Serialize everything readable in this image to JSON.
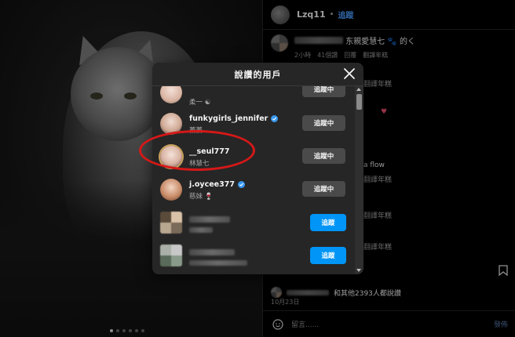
{
  "post": {
    "username": "Lzq11",
    "header_separator": "•",
    "header_follow_label": "追蹤",
    "caption_text": "东親愛慧七 🐾 的く",
    "caption_meta": [
      "2小時",
      "41個讚",
      "回覆",
      "翻譯年糕"
    ],
    "bg_comments": [
      {
        "text": "翻譯年糕"
      },
      {
        "text": "翻譯年糕"
      },
      {
        "text": "a flow"
      },
      {
        "text": "翻譯年糕"
      },
      {
        "text": "翻譯年糕"
      }
    ],
    "likes_text": "和其他2393人都說讚",
    "date": "10月23日",
    "comment_placeholder": "留言......",
    "post_button": "發佈",
    "carousel_dots": 6
  },
  "modal": {
    "title": "說讚的用戶",
    "users": [
      {
        "username": "",
        "subtitle": "柔一 ☯",
        "verified": false,
        "button": "追蹤中",
        "button_type": "following",
        "blurred": false
      },
      {
        "username": "funkygirls_jennifer",
        "subtitle": "蓁蓁",
        "verified": true,
        "button": "追蹤中",
        "button_type": "following",
        "blurred": false
      },
      {
        "username": "__seul777",
        "subtitle": "林慧七",
        "verified": false,
        "button": "追蹤中",
        "button_type": "following",
        "blurred": false,
        "highlighted": true
      },
      {
        "username": "j.oycee377",
        "subtitle": "慈妹 🍷",
        "verified": true,
        "button": "追蹤中",
        "button_type": "following",
        "blurred": false
      },
      {
        "username": "",
        "subtitle": "",
        "verified": false,
        "button": "追蹤",
        "button_type": "follow",
        "blurred": true
      },
      {
        "username": "",
        "subtitle": "",
        "verified": false,
        "button": "追蹤",
        "button_type": "follow",
        "blurred": true
      },
      {
        "username": "",
        "subtitle": "",
        "verified": false,
        "button": "追蹤",
        "button_type": "follow",
        "blurred": true
      }
    ]
  },
  "colors": {
    "accent": "#0095f6",
    "annotation": "#d51818",
    "modal_bg": "#262626"
  }
}
